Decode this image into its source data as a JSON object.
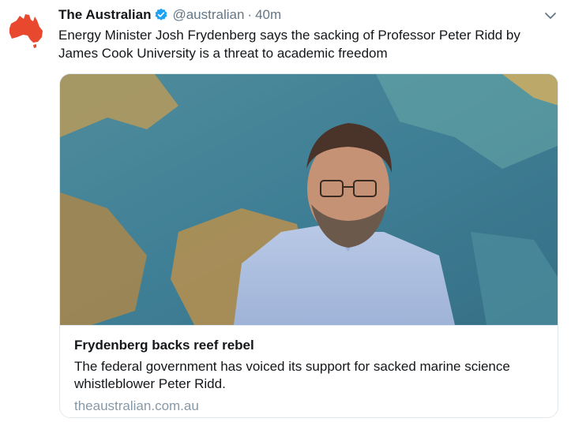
{
  "tweet": {
    "author_name": "The Australian",
    "handle": "@australian",
    "separator": "·",
    "time": "40m",
    "text": "Energy Minister Josh Frydenberg says the sacking of Professor Peter Ridd by James Cook University is a threat to academic freedom",
    "avatar_icon": "australia-map-icon",
    "verified_icon": "verified-badge-icon",
    "menu_icon": "chevron-down-icon"
  },
  "card": {
    "title": "Frydenberg backs reef rebel",
    "description": "The federal government has voiced its support for sacked marine science whistleblower Peter Ridd.",
    "url": "theaustralian.com.au",
    "image_icon": "article-photo"
  },
  "colors": {
    "brand_red": "#e8482e",
    "verified_blue": "#1da1f2",
    "muted_gray": "#657786",
    "url_gray": "#8899a6"
  }
}
